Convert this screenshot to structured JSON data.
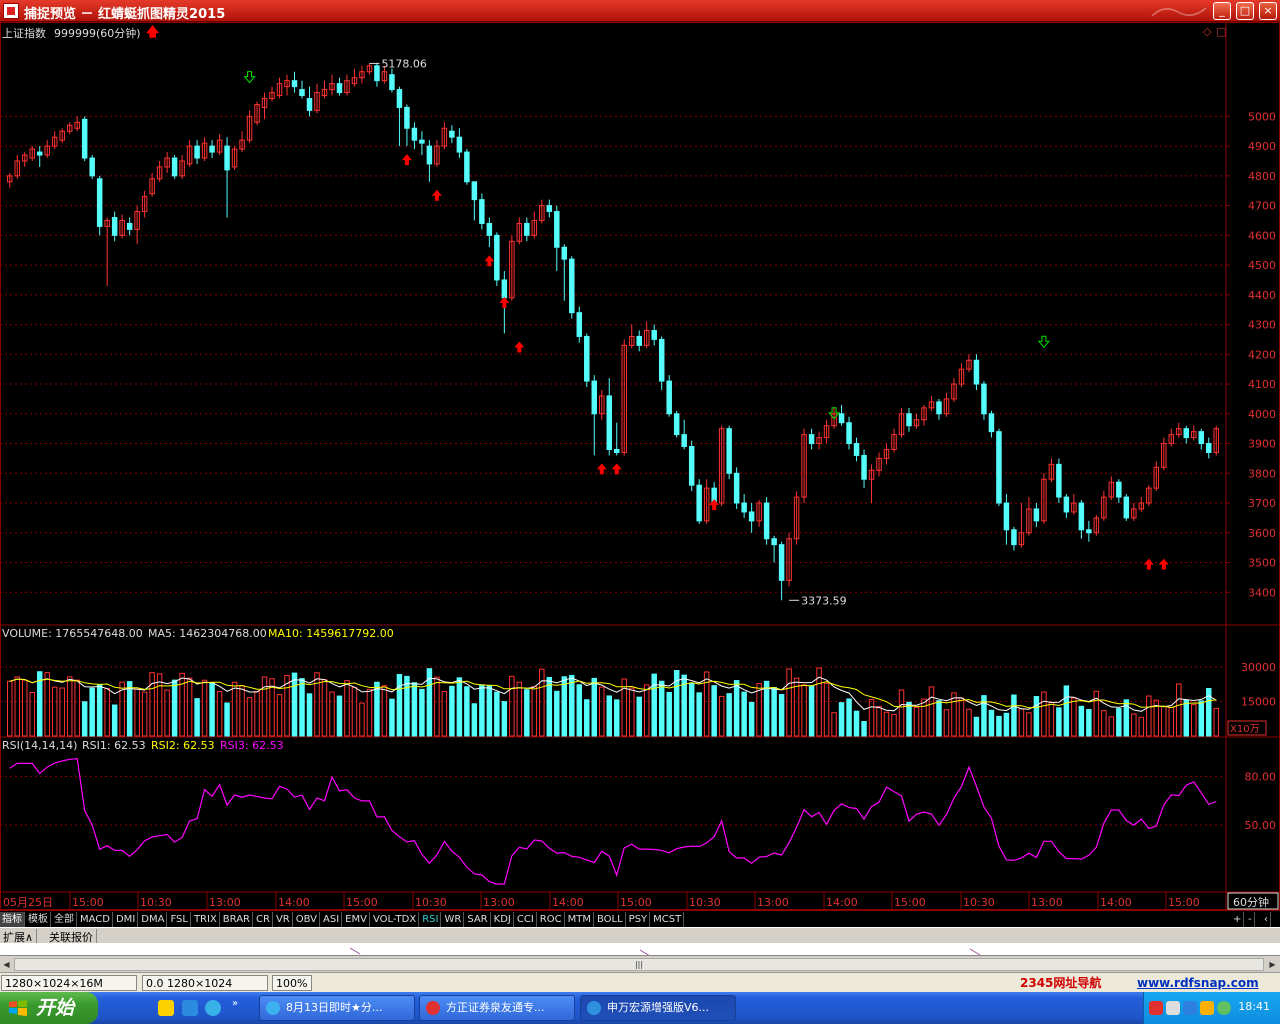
{
  "window": {
    "title": "捕捉预览 － 红蜻蜓抓图精灵2015",
    "buttons": [
      "_",
      "□",
      "×"
    ]
  },
  "chart_header": {
    "security": "上证指数",
    "code_period": "999999(60分钟)",
    "marks": [
      "◇",
      "□"
    ]
  },
  "price_labels": {
    "high": "5178.06",
    "low": "3373.59"
  },
  "volume_header": {
    "label": "VOLUME: 1765547648.00",
    "ma5": "MA5: 1462304768.00",
    "ma10": "MA10: 1459617792.00"
  },
  "rsi_header": {
    "label": "RSI(14,14,14)",
    "rsi1": "RSI1: 62.53",
    "rsi2": "RSI2: 62.53",
    "rsi3": "RSI3: 62.53"
  },
  "colors": {
    "up": "#ff3232",
    "down": "#54fcfc",
    "grid": "#8a0000",
    "text_white": "#dddddd",
    "ma5": "#ffffff",
    "ma10": "#ffff00",
    "rsi": "#ff00ff",
    "signal_up": "#ff0000",
    "signal_down": "#00e000"
  },
  "price_axis": [
    "5000",
    "4900",
    "4800",
    "4700",
    "4600",
    "4500",
    "4400",
    "4300",
    "4200",
    "4100",
    "4000",
    "3900",
    "3800",
    "3700",
    "3600",
    "3500",
    "3400"
  ],
  "volume_axis": [
    "30000",
    "15000",
    "X10万"
  ],
  "rsi_axis": [
    "80.00",
    "50.00"
  ],
  "period_label": "60分钟",
  "time_axis": [
    "05月25日",
    "15:00",
    "10:30",
    "13:00",
    "14:00",
    "15:00",
    "10:30",
    "13:00",
    "14:00",
    "15:00",
    "10:30",
    "13:00",
    "14:00",
    "15:00",
    "10:30",
    "13:00",
    "14:00",
    "15:00"
  ],
  "tabs": [
    "指标",
    "模板",
    "全部",
    "MACD",
    "DMI",
    "DMA",
    "FSL",
    "TRIX",
    "BRAR",
    "CR",
    "VR",
    "OBV",
    "ASI",
    "EMV",
    "VOL-TDX",
    "RSI",
    "WR",
    "SAR",
    "KDJ",
    "CCI",
    "ROC",
    "MTM",
    "BOLL",
    "PSY",
    "MCST"
  ],
  "tab_right": [
    "+",
    "-",
    "‹"
  ],
  "extension_bar": [
    "扩展∧",
    "关联报价"
  ],
  "statusbar": {
    "size": "1280×1024×16M",
    "coords": "0.0 1280×1024",
    "zoom": "100%",
    "link1": "2345网址导航",
    "link2": "www.rdfsnap.com"
  },
  "taskbar": {
    "start": "开始",
    "tasks": [
      "8月13日即时★分...",
      "方正证券泉友通专...",
      "申万宏源增强版V6..."
    ],
    "clock": "18:41"
  },
  "chart_data": {
    "type": "candlestick",
    "ylim": [
      3300,
      5250
    ],
    "candles": [
      [
        4780,
        4800,
        4760,
        4810
      ],
      [
        4800,
        4850,
        4790,
        4870
      ],
      [
        4850,
        4870,
        4830,
        4880
      ],
      [
        4860,
        4890,
        4850,
        4900
      ],
      [
        4880,
        4870,
        4830,
        4900
      ],
      [
        4870,
        4900,
        4860,
        4920
      ],
      [
        4900,
        4930,
        4890,
        4950
      ],
      [
        4920,
        4950,
        4910,
        4960
      ],
      [
        4950,
        4970,
        4940,
        4980
      ],
      [
        4960,
        4980,
        4950,
        5000
      ],
      [
        4990,
        4860,
        4850,
        5000
      ],
      [
        4860,
        4800,
        4790,
        4870
      ],
      [
        4790,
        4630,
        4600,
        4800
      ],
      [
        4630,
        4650,
        4430,
        4660
      ],
      [
        4660,
        4600,
        4580,
        4680
      ],
      [
        4600,
        4650,
        4590,
        4670
      ],
      [
        4640,
        4620,
        4600,
        4660
      ],
      [
        4620,
        4680,
        4570,
        4700
      ],
      [
        4680,
        4730,
        4660,
        4750
      ],
      [
        4740,
        4790,
        4730,
        4810
      ],
      [
        4790,
        4830,
        4780,
        4850
      ],
      [
        4830,
        4860,
        4810,
        4880
      ],
      [
        4860,
        4800,
        4790,
        4870
      ],
      [
        4800,
        4850,
        4790,
        4870
      ],
      [
        4840,
        4900,
        4830,
        4920
      ],
      [
        4900,
        4860,
        4840,
        4920
      ],
      [
        4860,
        4910,
        4850,
        4930
      ],
      [
        4900,
        4880,
        4860,
        4920
      ],
      [
        4880,
        4920,
        4870,
        4940
      ],
      [
        4900,
        4820,
        4660,
        4930
      ],
      [
        4830,
        4890,
        4820,
        4900
      ],
      [
        4890,
        4920,
        4880,
        4950
      ],
      [
        4920,
        5000,
        4910,
        5020
      ],
      [
        4980,
        5040,
        4970,
        5050
      ],
      [
        5030,
        5060,
        4990,
        5080
      ],
      [
        5060,
        5080,
        5050,
        5100
      ],
      [
        5070,
        5110,
        5060,
        5130
      ],
      [
        5100,
        5120,
        5070,
        5140
      ],
      [
        5120,
        5100,
        5080,
        5150
      ],
      [
        5090,
        5070,
        5060,
        5120
      ],
      [
        5060,
        5020,
        5000,
        5100
      ],
      [
        5020,
        5080,
        5010,
        5110
      ],
      [
        5070,
        5090,
        5060,
        5120
      ],
      [
        5090,
        5110,
        5070,
        5140
      ],
      [
        5110,
        5080,
        5070,
        5130
      ],
      [
        5080,
        5120,
        5070,
        5140
      ],
      [
        5110,
        5130,
        5100,
        5160
      ],
      [
        5130,
        5150,
        5110,
        5170
      ],
      [
        5150,
        5170,
        5140,
        5178
      ],
      [
        5170,
        5120,
        5100,
        5180
      ],
      [
        5120,
        5150,
        5110,
        5170
      ],
      [
        5140,
        5090,
        5080,
        5160
      ],
      [
        5090,
        5030,
        4900,
        5100
      ],
      [
        5030,
        4960,
        4900,
        5040
      ],
      [
        4960,
        4920,
        4890,
        4980
      ],
      [
        4920,
        4910,
        4870,
        4950
      ],
      [
        4900,
        4840,
        4780,
        4920
      ],
      [
        4840,
        4900,
        4830,
        4920
      ],
      [
        4900,
        4960,
        4890,
        4980
      ],
      [
        4950,
        4930,
        4910,
        4970
      ],
      [
        4930,
        4880,
        4860,
        4960
      ],
      [
        4880,
        4780,
        4770,
        4890
      ],
      [
        4780,
        4720,
        4650,
        4780
      ],
      [
        4720,
        4640,
        4620,
        4740
      ],
      [
        4640,
        4600,
        4560,
        4660
      ],
      [
        4600,
        4450,
        4430,
        4610
      ],
      [
        4450,
        4390,
        4270,
        4480
      ],
      [
        4390,
        4580,
        4380,
        4600
      ],
      [
        4580,
        4640,
        4570,
        4660
      ],
      [
        4640,
        4600,
        4580,
        4660
      ],
      [
        4600,
        4650,
        4590,
        4680
      ],
      [
        4650,
        4700,
        4640,
        4720
      ],
      [
        4700,
        4680,
        4660,
        4720
      ],
      [
        4680,
        4560,
        4480,
        4700
      ],
      [
        4560,
        4520,
        4380,
        4570
      ],
      [
        4520,
        4340,
        4320,
        4530
      ],
      [
        4340,
        4260,
        4240,
        4360
      ],
      [
        4260,
        4110,
        4090,
        4270
      ],
      [
        4110,
        4000,
        3860,
        4130
      ],
      [
        4000,
        4060,
        3980,
        4080
      ],
      [
        4060,
        3880,
        3860,
        4120
      ],
      [
        3880,
        3870,
        3860,
        3970
      ],
      [
        3870,
        4230,
        3860,
        4250
      ],
      [
        4230,
        4260,
        4220,
        4300
      ],
      [
        4260,
        4230,
        4210,
        4280
      ],
      [
        4230,
        4280,
        4220,
        4310
      ],
      [
        4280,
        4250,
        4230,
        4300
      ],
      [
        4250,
        4110,
        4080,
        4260
      ],
      [
        4110,
        4000,
        3990,
        4130
      ],
      [
        4000,
        3930,
        3920,
        4010
      ],
      [
        3930,
        3890,
        3880,
        3980
      ],
      [
        3890,
        3760,
        3740,
        3910
      ],
      [
        3760,
        3640,
        3630,
        3780
      ],
      [
        3640,
        3750,
        3630,
        3780
      ],
      [
        3750,
        3700,
        3680,
        3770
      ],
      [
        3700,
        3950,
        3690,
        3960
      ],
      [
        3950,
        3800,
        3780,
        3960
      ],
      [
        3800,
        3700,
        3680,
        3820
      ],
      [
        3700,
        3670,
        3650,
        3730
      ],
      [
        3670,
        3640,
        3600,
        3700
      ],
      [
        3640,
        3700,
        3620,
        3710
      ],
      [
        3700,
        3580,
        3560,
        3720
      ],
      [
        3580,
        3560,
        3500,
        3590
      ],
      [
        3560,
        3440,
        3373,
        3570
      ],
      [
        3440,
        3580,
        3420,
        3600
      ],
      [
        3580,
        3720,
        3560,
        3740
      ],
      [
        3720,
        3930,
        3700,
        3950
      ],
      [
        3930,
        3900,
        3880,
        3950
      ],
      [
        3900,
        3920,
        3880,
        3940
      ],
      [
        3920,
        3960,
        3900,
        3980
      ],
      [
        3960,
        4000,
        3950,
        4020
      ],
      [
        4000,
        3970,
        3960,
        4030
      ],
      [
        3970,
        3900,
        3880,
        3990
      ],
      [
        3900,
        3860,
        3840,
        3920
      ],
      [
        3860,
        3780,
        3750,
        3880
      ],
      [
        3780,
        3810,
        3700,
        3830
      ],
      [
        3810,
        3850,
        3790,
        3870
      ],
      [
        3850,
        3880,
        3830,
        3900
      ],
      [
        3880,
        3930,
        3870,
        3950
      ],
      [
        3930,
        4000,
        3920,
        4020
      ],
      [
        4000,
        3960,
        3940,
        4020
      ],
      [
        3960,
        3980,
        3950,
        4000
      ],
      [
        3980,
        4020,
        3960,
        4030
      ],
      [
        4020,
        4040,
        4010,
        4060
      ],
      [
        4040,
        4000,
        3980,
        4050
      ],
      [
        4000,
        4050,
        3990,
        4070
      ],
      [
        4050,
        4100,
        4040,
        4120
      ],
      [
        4100,
        4150,
        4090,
        4170
      ],
      [
        4150,
        4180,
        4140,
        4200
      ],
      [
        4180,
        4100,
        4080,
        4200
      ],
      [
        4100,
        4000,
        3980,
        4110
      ],
      [
        4000,
        3940,
        3920,
        4010
      ],
      [
        3940,
        3700,
        3690,
        3950
      ],
      [
        3700,
        3610,
        3560,
        3730
      ],
      [
        3610,
        3560,
        3540,
        3620
      ],
      [
        3560,
        3600,
        3550,
        3700
      ],
      [
        3600,
        3680,
        3590,
        3720
      ],
      [
        3680,
        3640,
        3620,
        3700
      ],
      [
        3640,
        3780,
        3630,
        3800
      ],
      [
        3780,
        3830,
        3770,
        3850
      ],
      [
        3830,
        3720,
        3700,
        3850
      ],
      [
        3720,
        3670,
        3650,
        3730
      ],
      [
        3670,
        3700,
        3660,
        3730
      ],
      [
        3700,
        3610,
        3580,
        3710
      ],
      [
        3610,
        3600,
        3570,
        3640
      ],
      [
        3600,
        3650,
        3590,
        3660
      ],
      [
        3650,
        3720,
        3640,
        3740
      ],
      [
        3720,
        3770,
        3710,
        3790
      ],
      [
        3770,
        3720,
        3700,
        3780
      ],
      [
        3720,
        3650,
        3640,
        3730
      ],
      [
        3650,
        3680,
        3640,
        3700
      ],
      [
        3680,
        3700,
        3670,
        3720
      ],
      [
        3700,
        3750,
        3690,
        3760
      ],
      [
        3750,
        3820,
        3740,
        3840
      ],
      [
        3820,
        3900,
        3810,
        3920
      ],
      [
        3900,
        3930,
        3890,
        3950
      ],
      [
        3930,
        3950,
        3920,
        3970
      ],
      [
        3950,
        3920,
        3900,
        3960
      ],
      [
        3920,
        3940,
        3910,
        3960
      ],
      [
        3940,
        3900,
        3880,
        3950
      ],
      [
        3900,
        3870,
        3850,
        3920
      ],
      [
        3870,
        3950,
        3860,
        3960
      ]
    ]
  }
}
